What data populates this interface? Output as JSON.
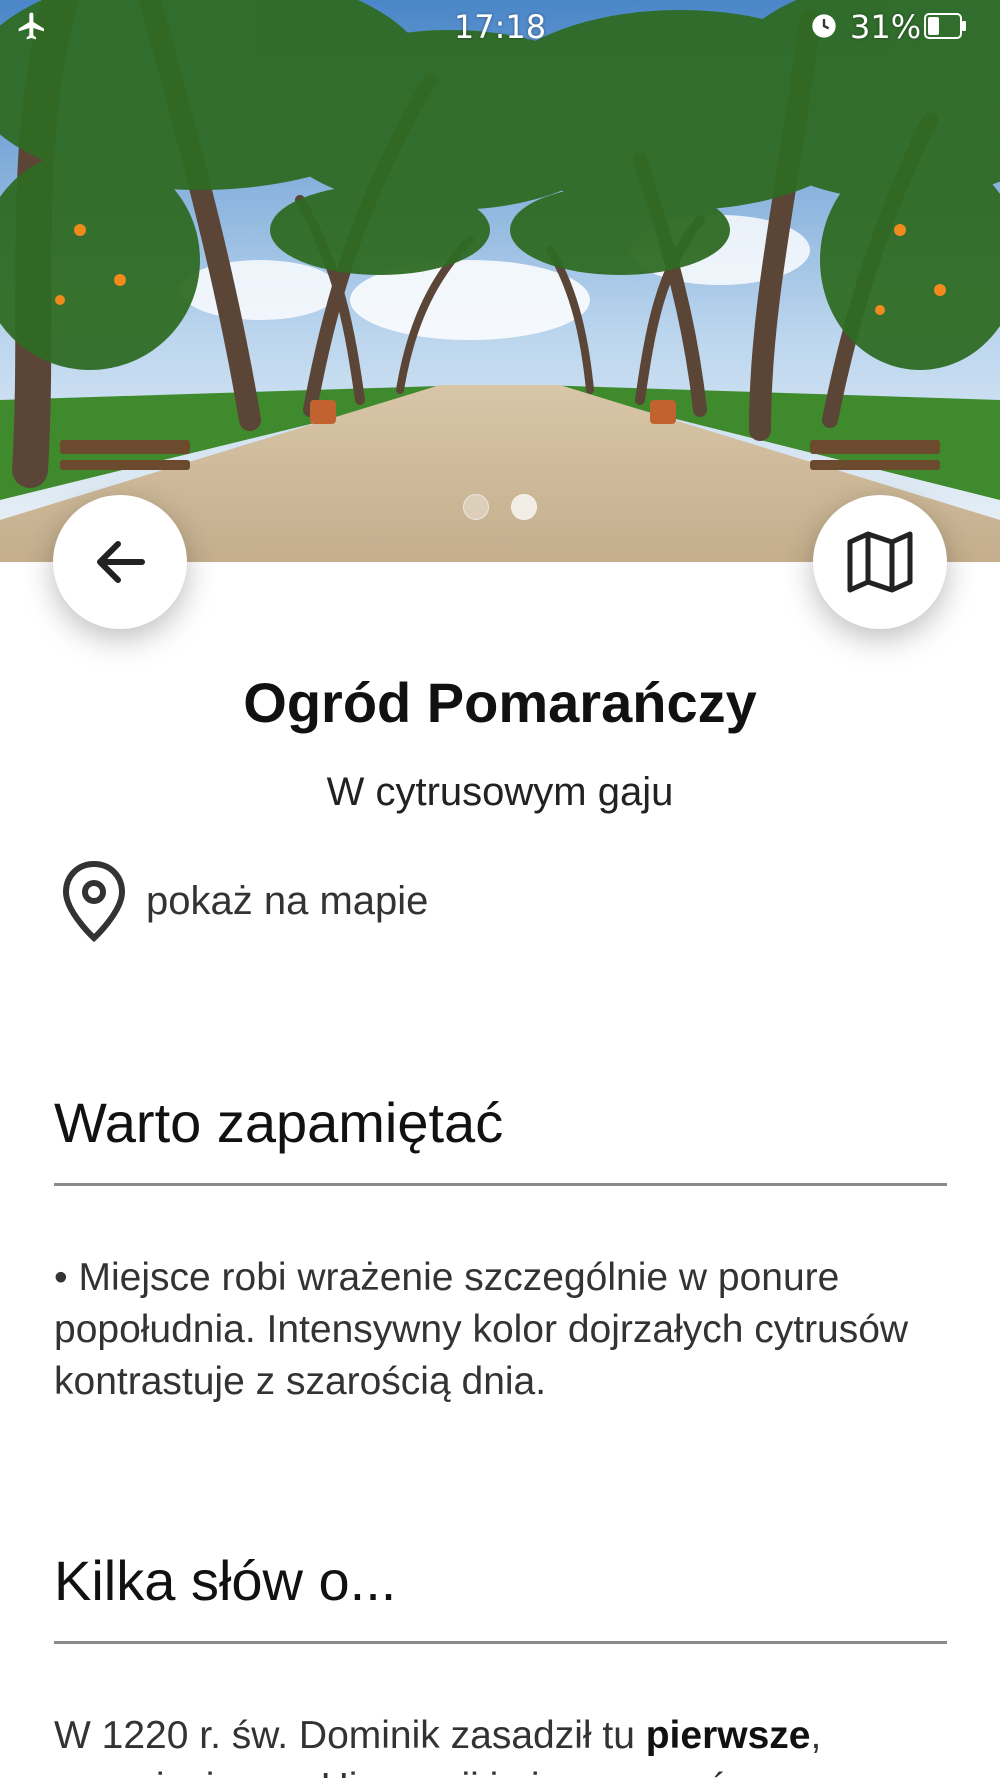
{
  "status_bar": {
    "time": "17:18",
    "battery": "31%",
    "icons": [
      "airplane-mode-icon",
      "alarm-icon",
      "battery-icon"
    ]
  },
  "hero": {
    "image": "tree-lined-garden-photo",
    "carousel_dots": 2,
    "active_dot": 1
  },
  "buttons": {
    "back_icon": "arrow-left-icon",
    "map_icon": "folded-map-icon"
  },
  "place": {
    "title": "Ogród Pomarańczy",
    "subtitle": "W cytrusowym gaju",
    "map_link": "pokaż na mapie"
  },
  "sections": {
    "remember": {
      "heading": "Warto zapamiętać",
      "text": "• Miejsce robi wrażenie szczególnie w ponure popołudnia. Intensywny kolor dojrzałych cytrusów kontrastuje z szarością dnia."
    },
    "about": {
      "heading": "Kilka słów o...",
      "text_before": "W 1220 r. św. Dominik zasadził tu ",
      "text_bold": "pierwsze",
      "text_after": ", przywiezione z Hiszpanii i nieznane wówczas"
    }
  },
  "colors": {
    "text": "#1a1a1a",
    "divider": "#8a8a8a",
    "background": "#ffffff"
  }
}
